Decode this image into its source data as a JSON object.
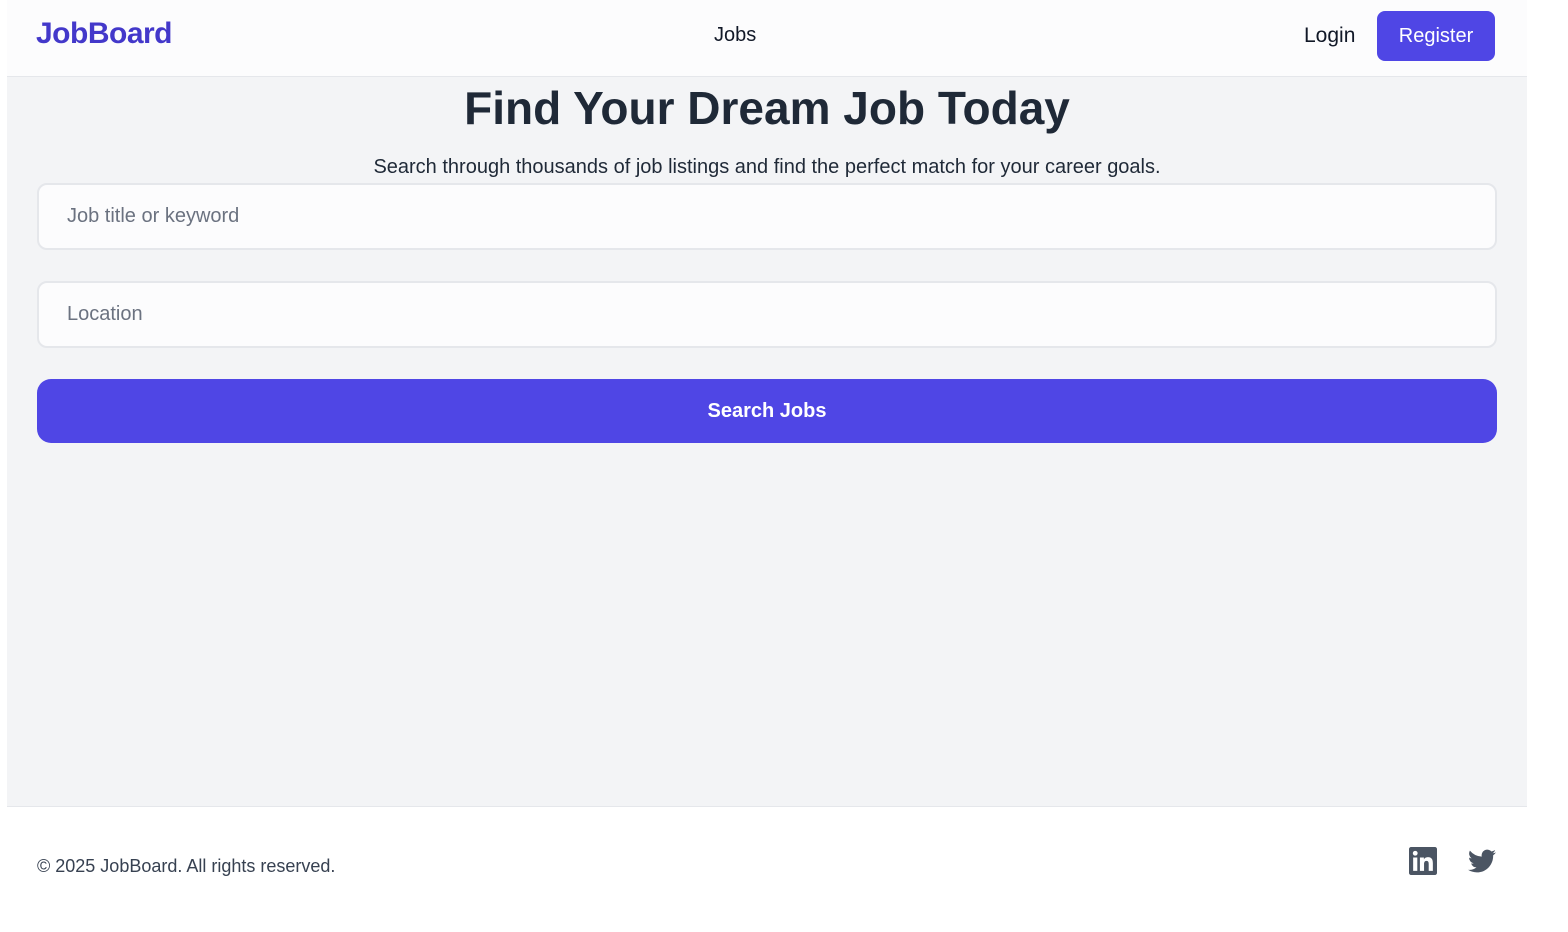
{
  "header": {
    "logo": "JobBoard",
    "nav": {
      "jobs": "Jobs"
    },
    "login_label": "Login",
    "register_label": "Register"
  },
  "hero": {
    "title": "Find Your Dream Job Today",
    "subtitle": "Search through thousands of job listings and find the perfect match for your career goals."
  },
  "search": {
    "keyword_placeholder": "Job title or keyword",
    "keyword_value": "",
    "location_placeholder": "Location",
    "location_value": "",
    "button_label": "Search Jobs"
  },
  "footer": {
    "copyright": "© 2025 JobBoard. All rights reserved.",
    "social": [
      {
        "icon": "linkedin-icon"
      },
      {
        "icon": "twitter-icon"
      }
    ]
  },
  "colors": {
    "brand": "#4f46e5",
    "logo": "#4338ca",
    "page_bg": "#f3f4f6",
    "text": "#1f2937",
    "icon": "#4b5563"
  }
}
